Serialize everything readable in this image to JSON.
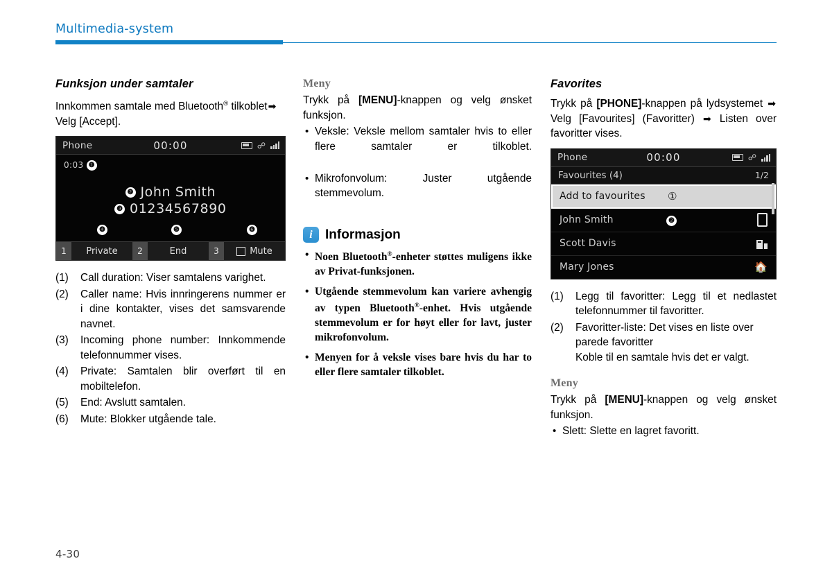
{
  "header": {
    "title": "Multimedia-system",
    "accent_color": "#1182c6"
  },
  "footer": {
    "page_number": "4-30"
  },
  "column1": {
    "section_title": "Funksjon under samtaler",
    "intro_line1": "Innkommen samtale med Bluetooth",
    "intro_reg": "®",
    "intro_line2_a": "tilkoblet",
    "intro_arrow": "➡",
    "intro_line2_b": " Velg [Accept].",
    "device": {
      "status_label": "Phone",
      "clock": "00:00",
      "call_duration": "0:03",
      "marker_1": "❶",
      "caller_name": "John Smith",
      "marker_2": "❷",
      "phone_number": "01234567890",
      "marker_3": "❸",
      "marker_4": "❹",
      "marker_5": "❺",
      "marker_6": "❻",
      "btn1_key": "1",
      "btn1_label": "Private",
      "btn2_key": "2",
      "btn2_label": "End",
      "btn3_key": "3",
      "btn3_label": "Mute"
    },
    "refs": [
      {
        "num": "(1)",
        "text": "Call duration: Viser samtalens varighet."
      },
      {
        "num": "(2)",
        "text": "Caller name: Hvis innringerens nummer er i dine kontakter, vises det samsvarende navnet."
      },
      {
        "num": "(3)",
        "text": "Incoming phone number: Innkommende telefonnummer vises."
      },
      {
        "num": "(4)",
        "text": "Private: Samtalen blir overført til en mobiltelefon."
      },
      {
        "num": "(5)",
        "text": "End: Avslutt samtalen."
      },
      {
        "num": "(6)",
        "text": "Mute: Blokker utgående tale."
      }
    ]
  },
  "column2": {
    "meny_heading": "Meny",
    "meny_text_pre": "Trykk på ",
    "meny_text_bold": "[MENU]",
    "meny_text_post": "-knappen og velg ønsket funksjon.",
    "bullets": [
      "Veksle: Veksle mellom samtaler hvis to eller flere samtaler er tilkoblet.",
      "Mikrofonvolum: Juster utgående stemmevolum."
    ],
    "info": {
      "icon_glyph": "i",
      "title": "Informasjon",
      "bullets": [
        {
          "pre": "Noen Bluetooth",
          "reg": "®",
          "post": "-enheter støttes muligens ikke av Privat-funksjonen."
        },
        {
          "pre": "Utgående stemmevolum kan variere avhengig av typen Bluetooth",
          "reg": "®",
          "post": "-enhet. Hvis utgående stemmevolum er for høyt eller for lavt, juster mikrofonvolum."
        },
        {
          "pre": "Menyen for å veksle vises bare hvis du har to eller flere samtaler tilkoblet.",
          "reg": "",
          "post": ""
        }
      ]
    }
  },
  "column3": {
    "section_title": "Favorites",
    "intro_pre": "Trykk på ",
    "intro_bold": "[PHONE]",
    "intro_mid": "-knappen på lydsystemet ",
    "arrow": "➡",
    "intro_mid2": " Velg [Favourites] (Favoritter) ",
    "intro_end": " Listen over favoritter vises.",
    "device": {
      "status_label": "Phone",
      "clock": "00:00",
      "list_title": "Favourites (4)",
      "page_indicator": "1/2",
      "rows": [
        {
          "name": "Add to favourites",
          "marker": "①",
          "icon": "",
          "selected": true
        },
        {
          "name": "John Smith",
          "marker": "❷",
          "icon": "mobile-icon",
          "selected": false
        },
        {
          "name": "Scott Davis",
          "marker": "",
          "icon": "office-icon",
          "selected": false
        },
        {
          "name": "Mary Jones",
          "marker": "",
          "icon": "home-icon",
          "selected": false
        }
      ]
    },
    "refs": [
      {
        "num": "(1)",
        "text": "Legg til favoritter: Legg til et nedlastet telefonnummer til favoritter.",
        "sub": ""
      },
      {
        "num": "(2)",
        "text": "Favoritter-liste: Det vises en liste over parede favoritter",
        "sub": "Koble til en samtale hvis det er valgt."
      }
    ],
    "meny_heading": "Meny",
    "meny_text_pre": "Trykk på ",
    "meny_text_bold": "[MENU]",
    "meny_text_post": "-knappen og velg ønsket funksjon.",
    "bullets": [
      "Slett: Slette en lagret favoritt."
    ]
  }
}
